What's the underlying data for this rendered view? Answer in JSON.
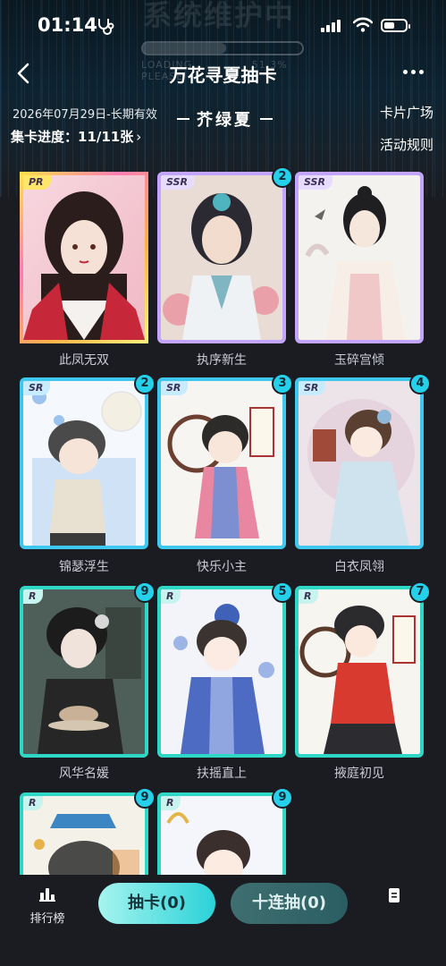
{
  "status_bar": {
    "time": "01:14"
  },
  "background": {
    "overlay_text": "系统维护中",
    "loading_label": "LOADING",
    "loading_percent": "51.3%",
    "loading_sub": "PLEASE",
    "loading_fraction": 0.52
  },
  "header": {
    "title": "万花寻夏抽卡",
    "back_icon": "chevron-left-icon",
    "more_icon": "more-dots-icon"
  },
  "info": {
    "date_text": "2026年07月29日-长期有效",
    "season_title": "芥绿夏",
    "progress_text": "集卡进度：11/11张",
    "card_plaza_link": "卡片广场",
    "rules_link": "活动规则"
  },
  "cards": [
    {
      "name": "此凤无双",
      "rarity": "PR",
      "count": ""
    },
    {
      "name": "执序新生",
      "rarity": "SSR",
      "count": "2"
    },
    {
      "name": "玉碎宫倾",
      "rarity": "SSR",
      "count": ""
    },
    {
      "name": "锦瑟浮生",
      "rarity": "SR",
      "count": "2"
    },
    {
      "name": "快乐小主",
      "rarity": "SR",
      "count": "3"
    },
    {
      "name": "白衣凤翎",
      "rarity": "SR",
      "count": "4"
    },
    {
      "name": "风华名媛",
      "rarity": "R",
      "count": "9"
    },
    {
      "name": "扶摇直上",
      "rarity": "R",
      "count": "5"
    },
    {
      "name": "掖庭初见",
      "rarity": "R",
      "count": "7"
    },
    {
      "name": "",
      "rarity": "R",
      "count": "9"
    },
    {
      "name": "",
      "rarity": "R",
      "count": "9"
    }
  ],
  "bottom_bar": {
    "rank_label": "排行榜",
    "draw_button": "抽卡(0)",
    "ten_draw_button": "十连抽(0)",
    "rank_icon": "bar-chart-icon",
    "doc_icon": "document-icon"
  },
  "colors": {
    "accent_cyan": "#25d0ea",
    "pr_gold": "#ffe56a",
    "ssr_purple": "#c3a4ff",
    "sr_blue": "#3ec8ef",
    "r_teal": "#2fd8c6"
  }
}
